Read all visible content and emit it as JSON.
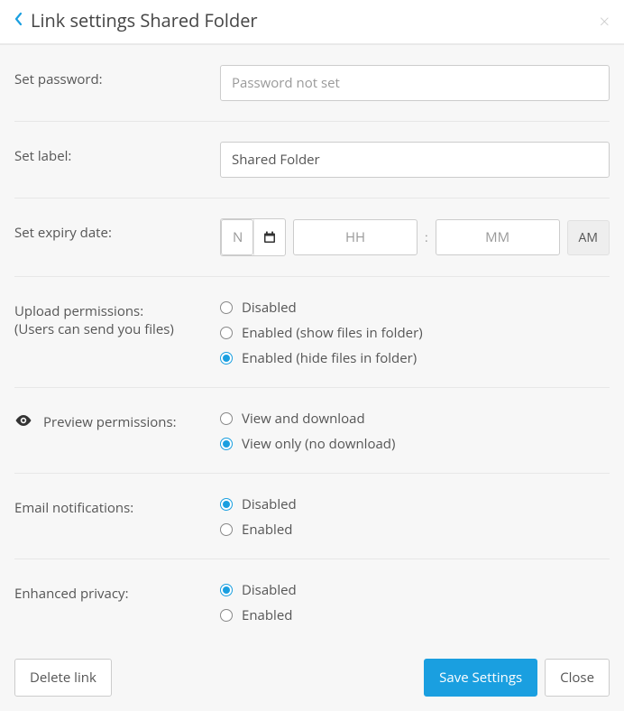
{
  "header": {
    "title": "Link settings Shared Folder"
  },
  "password": {
    "label": "Set password:",
    "placeholder": "Password not set",
    "value": ""
  },
  "label_row": {
    "label": "Set label:",
    "value": "Shared Folder"
  },
  "expiry": {
    "label": "Set expiry date:",
    "date_placeholder": "No expiry date",
    "date_value": "",
    "hh_placeholder": "HH",
    "hh_value": "",
    "mm_placeholder": "MM",
    "mm_value": "",
    "ampm": "AM"
  },
  "upload": {
    "label": "Upload permissions:",
    "sublabel": "(Users can send you files)",
    "options": [
      {
        "label": "Disabled",
        "checked": false
      },
      {
        "label": "Enabled (show files in folder)",
        "checked": false
      },
      {
        "label": "Enabled (hide files in folder)",
        "checked": true
      }
    ]
  },
  "preview": {
    "label": "Preview permissions:",
    "options": [
      {
        "label": "View and download",
        "checked": false
      },
      {
        "label": "View only (no download)",
        "checked": true
      }
    ]
  },
  "email": {
    "label": "Email notifications:",
    "options": [
      {
        "label": "Disabled",
        "checked": true
      },
      {
        "label": "Enabled",
        "checked": false
      }
    ]
  },
  "privacy": {
    "label": "Enhanced privacy:",
    "options": [
      {
        "label": "Disabled",
        "checked": true
      },
      {
        "label": "Enabled",
        "checked": false
      }
    ]
  },
  "footer": {
    "delete": "Delete link",
    "save": "Save Settings",
    "close": "Close"
  }
}
